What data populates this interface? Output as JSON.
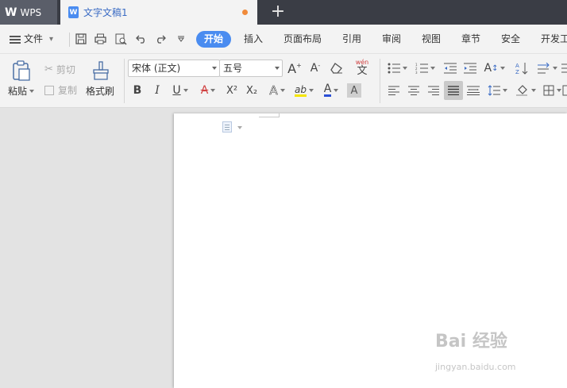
{
  "titlebar": {
    "app_tab": "WPS",
    "doc_tab": "文字文稿1",
    "new_tab": "+",
    "doc_icon_letter": "W"
  },
  "menu": {
    "file": "文件",
    "tabs": [
      "开始",
      "插入",
      "页面布局",
      "引用",
      "审阅",
      "视图",
      "章节",
      "安全",
      "开发工"
    ]
  },
  "ribbon": {
    "paste": "粘贴",
    "cut": "剪切",
    "copy": "复制",
    "format_painter": "格式刷",
    "font_name": "宋体 (正文)",
    "font_size": "五号",
    "bold": "B",
    "italic": "I",
    "underline": "U",
    "strikethrough": "A",
    "superscript": "X²",
    "subscript": "X₂",
    "text_effect": "A",
    "highlight": "ab",
    "font_color": "A",
    "char_shading": "A",
    "grow_font": "A",
    "shrink_font": "A",
    "phonetic": "wén"
  },
  "colors": {
    "accent": "#4a8cf0",
    "titlebar": "#3a3d45",
    "modified_dot": "#f08a3a",
    "highlight_yellow": "#f5e600",
    "font_color_red": "#e53935",
    "font_color_blue": "#2a4fd6"
  },
  "watermark": {
    "main": "Bai 经验",
    "sub": "jingyan.baidu.com"
  }
}
